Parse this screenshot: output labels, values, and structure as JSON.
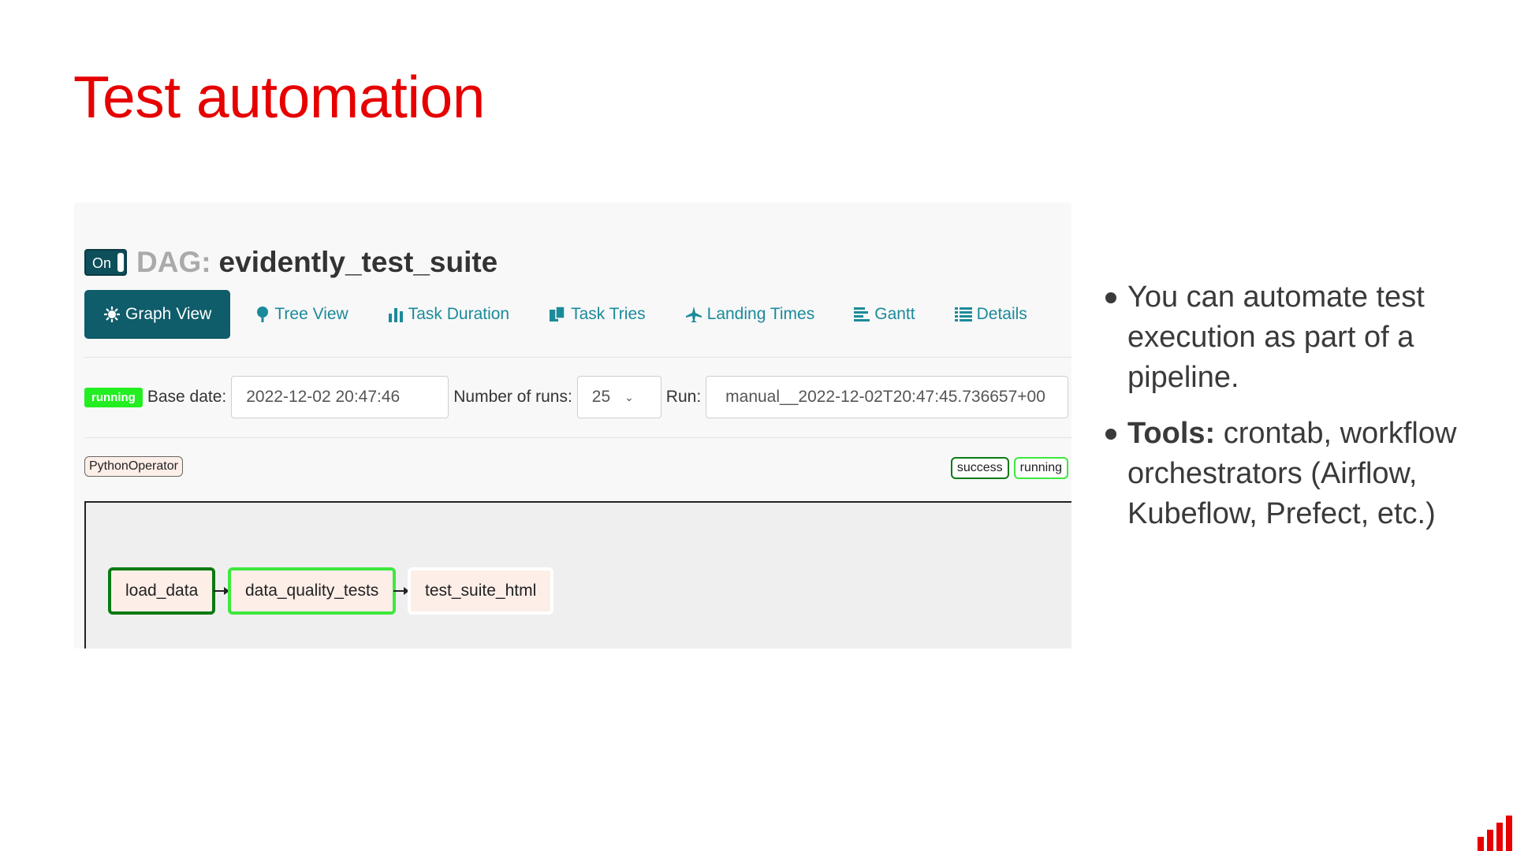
{
  "slide": {
    "title": "Test automation",
    "bullets": [
      {
        "bold": "",
        "text": "You can automate test execution as part of a pipeline."
      },
      {
        "bold": "Tools:",
        "text": " crontab, workflow orchestrators (Airflow, Kubeflow, Prefect, etc.)"
      }
    ]
  },
  "airflow": {
    "toggle_label": "On",
    "dag_prefix": "DAG:",
    "dag_name": "evidently_test_suite",
    "tabs": [
      {
        "label": "Graph View",
        "icon": "sun-icon"
      },
      {
        "label": "Tree View",
        "icon": "tree-icon"
      },
      {
        "label": "Task Duration",
        "icon": "bar-chart-icon"
      },
      {
        "label": "Task Tries",
        "icon": "files-icon"
      },
      {
        "label": "Landing Times",
        "icon": "plane-icon"
      },
      {
        "label": "Gantt",
        "icon": "align-left-icon"
      },
      {
        "label": "Details",
        "icon": "list-icon"
      }
    ],
    "status_badge": "running",
    "base_date_label": "Base date:",
    "base_date_value": "2022-12-02 20:47:46",
    "num_runs_label": "Number of runs:",
    "num_runs_value": "25",
    "run_label": "Run:",
    "run_value": "manual__2022-12-02T20:47:45.736657+00",
    "operator_tag": "PythonOperator",
    "legend": [
      "success",
      "running"
    ],
    "nodes": [
      "load_data",
      "data_quality_tests",
      "test_suite_html"
    ],
    "colors": {
      "accent": "#0f5c6a",
      "link": "#1b8a9a",
      "success": "#0a7a12",
      "running": "#3ee83e",
      "title": "#e60000"
    }
  }
}
